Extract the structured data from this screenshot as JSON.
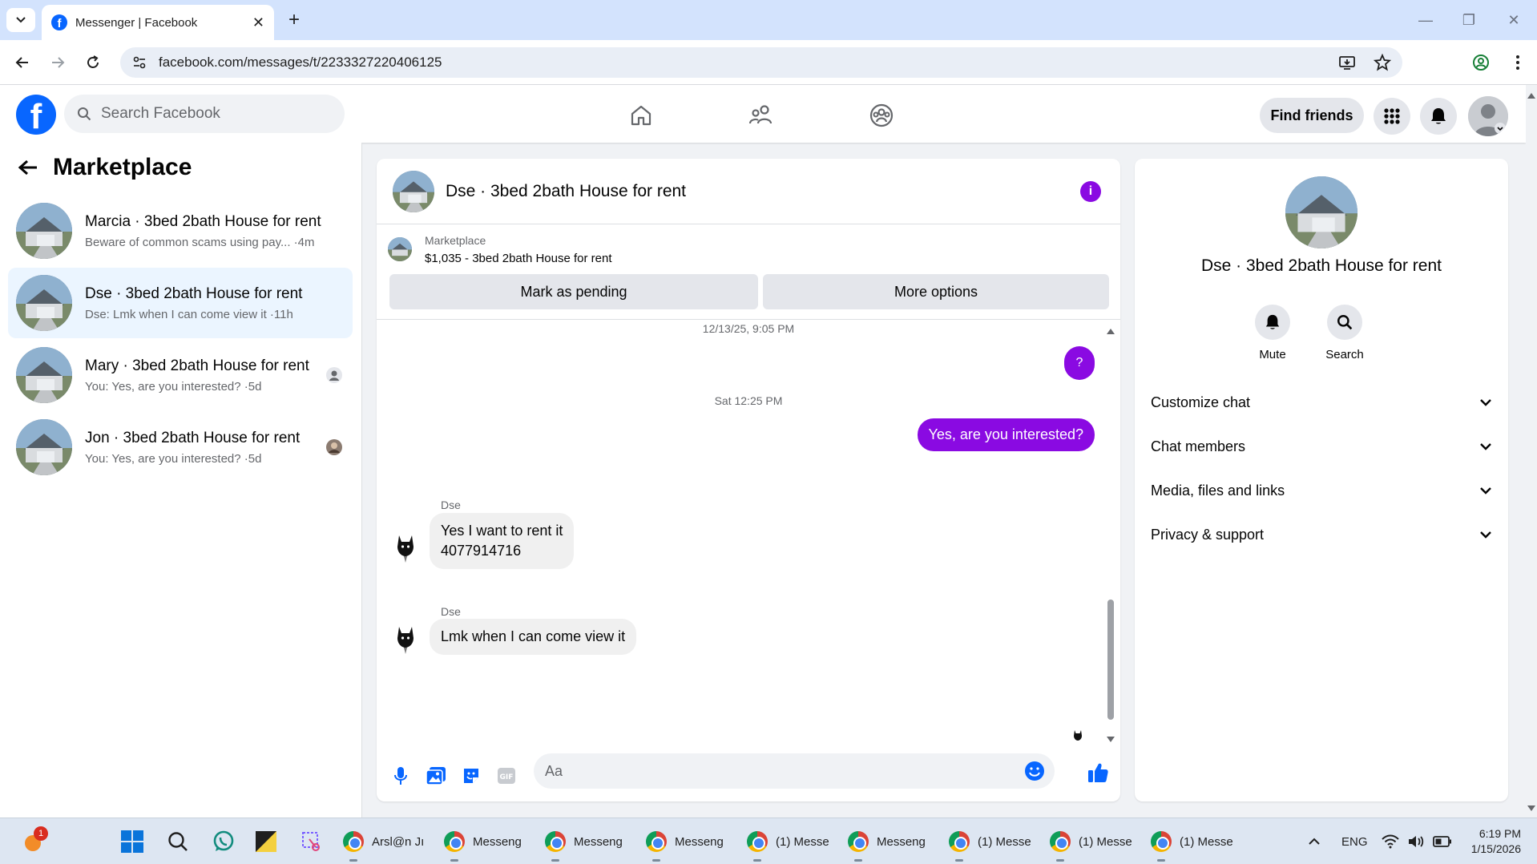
{
  "browser": {
    "tab_title": "Messenger | Facebook",
    "url": "facebook.com/messages/t/2233327220406125"
  },
  "fb_header": {
    "logo_letter": "f",
    "search_placeholder": "Search Facebook",
    "find_friends": "Find friends"
  },
  "left_panel": {
    "title": "Marketplace",
    "conversations": [
      {
        "name": "Marcia · 3bed 2bath House for rent",
        "preview": "Beware of common scams using pay... ·4m",
        "active": false
      },
      {
        "name": "Dse · 3bed 2bath House for rent",
        "preview": "Dse: Lmk when I can come view it ·11h",
        "active": true
      },
      {
        "name": "Mary · 3bed 2bath House for rent",
        "preview": "You: Yes, are you interested? ·5d",
        "active": false
      },
      {
        "name": "Jon · 3bed 2bath House for rent",
        "preview": "You: Yes, are you interested? ·5d",
        "active": false
      }
    ]
  },
  "chat": {
    "title": "Dse · 3bed 2bath House for rent",
    "info_icon": "i",
    "marketplace_label": "Marketplace",
    "listing": "$1,035 - 3bed 2bath House for rent",
    "mark_pending": "Mark as pending",
    "more_options": "More options",
    "messages": {
      "stamp1": "12/13/25, 9:05 PM",
      "q_bubble": "?",
      "stamp2": "Sat 12:25 PM",
      "outgoing1": "Yes, are you interested?",
      "sender1": "Dse",
      "incoming1_line1": "Yes I want to rent it",
      "incoming1_line2": "4077914716",
      "sender2": "Dse",
      "incoming2": "Lmk when I can come view it"
    },
    "composer_placeholder": "Aa"
  },
  "right_panel": {
    "name": "Dse · 3bed 2bath House for rent",
    "mute": "Mute",
    "search": "Search",
    "sections": [
      "Customize chat",
      "Chat members",
      "Media, files and links",
      "Privacy & support"
    ]
  },
  "taskbar": {
    "badge": "1",
    "apps": [
      "Arsl@n Jı",
      "Messeng",
      "Messeng",
      "Messeng",
      "(1) Messe",
      "Messeng",
      "(1) Messe",
      "(1) Messe",
      "(1) Messe"
    ],
    "lang": "ENG",
    "time": "6:19 PM",
    "date": "1/15/2026"
  },
  "colors": {
    "accent_purple": "#8a0ae2",
    "fb_blue": "#0866ff",
    "active_row": "#ebf5ff"
  }
}
